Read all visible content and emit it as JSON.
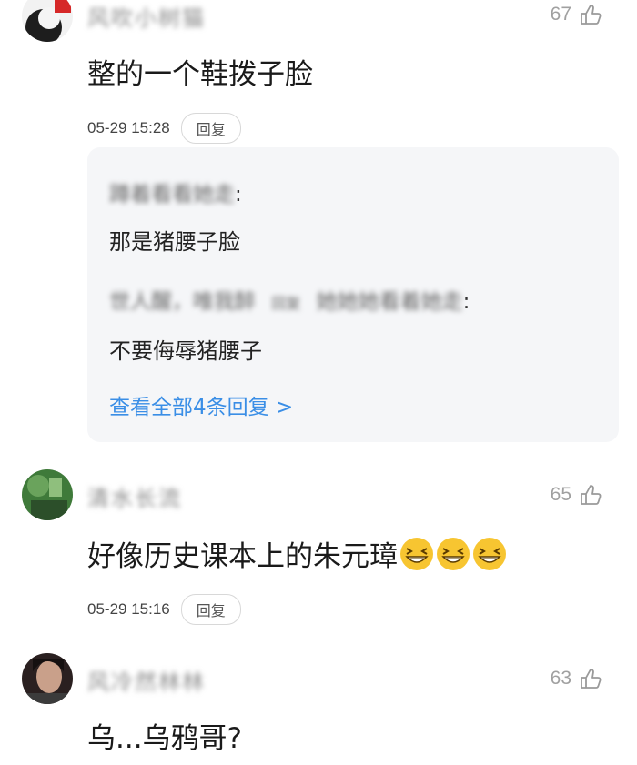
{
  "comments": [
    {
      "username": "风吹小树猫",
      "likes": "67",
      "text": "整的一个鞋拨子脸",
      "time": "05-29 15:28",
      "reply_label": "回复",
      "replies": [
        {
          "name": "蹲着看看她走",
          "colon": ":",
          "text": "那是猪腰子脸"
        },
        {
          "name_part1": "世人醒，唯我醉",
          "name_part2": "回复",
          "name_part3": "她她她看着她走",
          "colon": ":",
          "text": "不要侮辱猪腰子"
        }
      ],
      "view_all": "查看全部4条回复 >"
    },
    {
      "username": "清水长流",
      "likes": "65",
      "text": "好像历史课本上的朱元璋",
      "emoji_count": 3,
      "time": "05-29 15:16",
      "reply_label": "回复"
    },
    {
      "username": "风冷然林林",
      "likes": "63",
      "text": "乌...乌鸦哥?"
    }
  ]
}
